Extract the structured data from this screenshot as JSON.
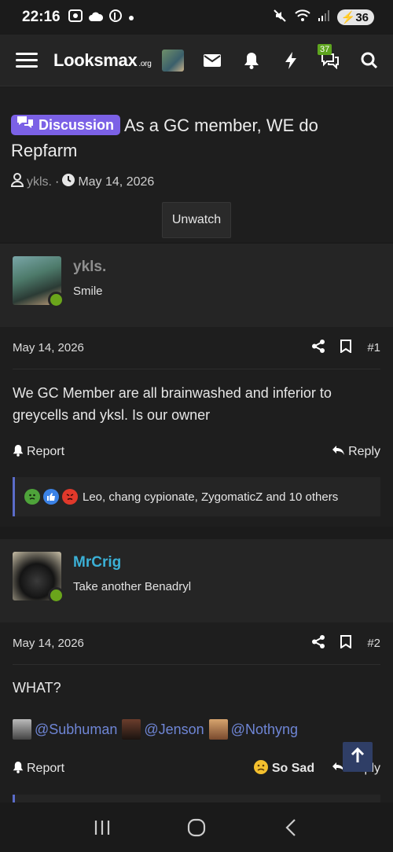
{
  "status": {
    "time": "22:16",
    "battery": "36"
  },
  "nav": {
    "logo": "Looksmax",
    "logo_suffix": ".org",
    "conversations_count": "37"
  },
  "thread": {
    "prefix": "Discussion",
    "title": "As a GC member, WE do Repfarm",
    "author": "ykls.",
    "date": "May 14, 2026",
    "watch_label": "Unwatch"
  },
  "posts": [
    {
      "username": "ykls.",
      "username_color": "#8f8f8f",
      "user_title": "Smile",
      "date": "May 14, 2026",
      "number": "#1",
      "text": "We GC Member are all brainwashed and inferior to greycells and yksl. Is our owner",
      "report_label": "Report",
      "reply_label": "Reply",
      "reactions_text": "Leo, chang cypionate, ZygomaticZ and 10 others"
    },
    {
      "username": "MrCrig",
      "username_color": "#3bb0d6",
      "user_title": "Take another Benadryl",
      "date": "May 14, 2026",
      "number": "#2",
      "text": "WHAT?",
      "mentions": [
        "@Subhuman",
        "@Jenson",
        "@Nothyng"
      ],
      "report_label": "Report",
      "reaction_label": "So Sad",
      "reply_label": "Reply"
    }
  ]
}
